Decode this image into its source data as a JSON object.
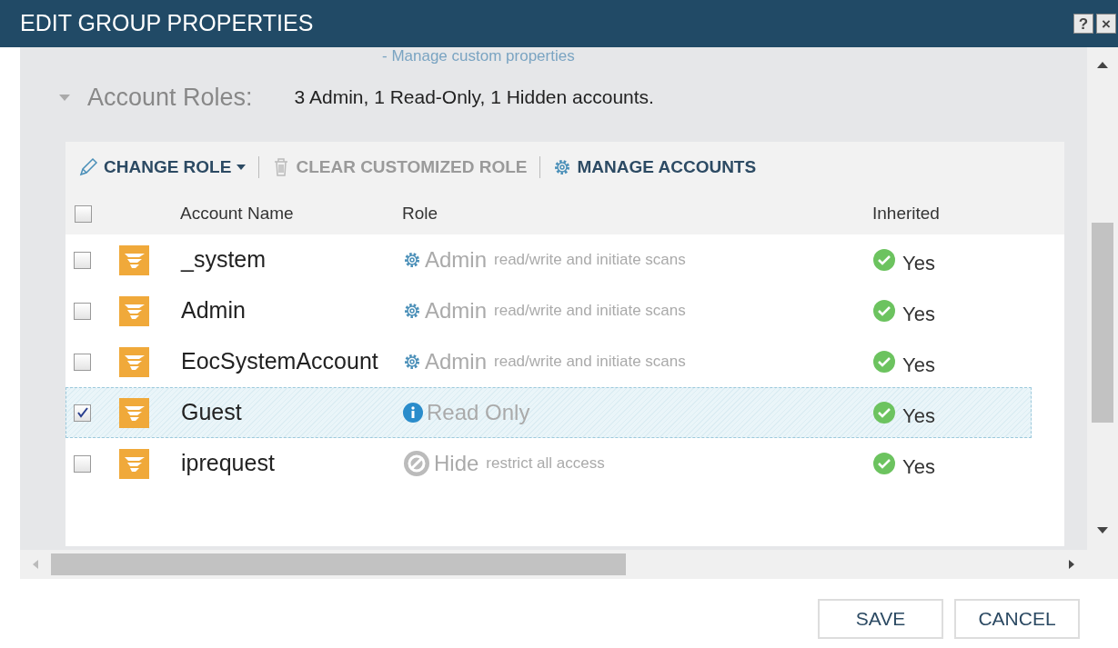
{
  "window": {
    "title": "EDIT GROUP PROPERTIES"
  },
  "title_buttons": [
    "?",
    "×"
  ],
  "custom_properties_link": "- Manage custom properties",
  "account_roles": {
    "label": "Account Roles:",
    "expanded": true,
    "summary": "3 Admin, 1 Read-Only, 1 Hidden accounts."
  },
  "toolbar": [
    {
      "label": "CHANGE ROLE",
      "kind": "edit",
      "disabled": false
    },
    {
      "label": "CLEAR CUSTOMIZED ROLE",
      "kind": "trash",
      "disabled": true
    },
    {
      "label": "MANAGE ACCOUNTS",
      "kind": "gear",
      "disabled": false
    }
  ],
  "table": {
    "select_all": {
      "checked": false
    },
    "columns": [
      "Account Name",
      "Role",
      "Inherited"
    ],
    "rows": [
      {
        "name": "_system",
        "role": "Admin",
        "kind": "admin",
        "role_note": "read/write and initiate scans",
        "inherited": "Yes",
        "checked": false,
        "selected": false
      },
      {
        "name": "Admin",
        "role": "Admin",
        "kind": "admin",
        "role_note": "read/write and initiate scans",
        "inherited": "Yes",
        "checked": false,
        "selected": false
      },
      {
        "name": "EocSystemAccount",
        "role": "Admin",
        "kind": "admin",
        "role_note": "read/write and initiate scans",
        "inherited": "Yes",
        "checked": false,
        "selected": false
      },
      {
        "name": "Guest",
        "role": "Read Only",
        "kind": "readonly",
        "inherited": "Yes",
        "checked": true,
        "selected": true
      },
      {
        "name": "iprequest",
        "role": "Hide",
        "kind": "hide",
        "role_note": "restrict all access",
        "inherited": "Yes",
        "checked": false,
        "selected": false
      }
    ]
  },
  "buttons": [
    "SAVE",
    "CANCEL"
  ]
}
